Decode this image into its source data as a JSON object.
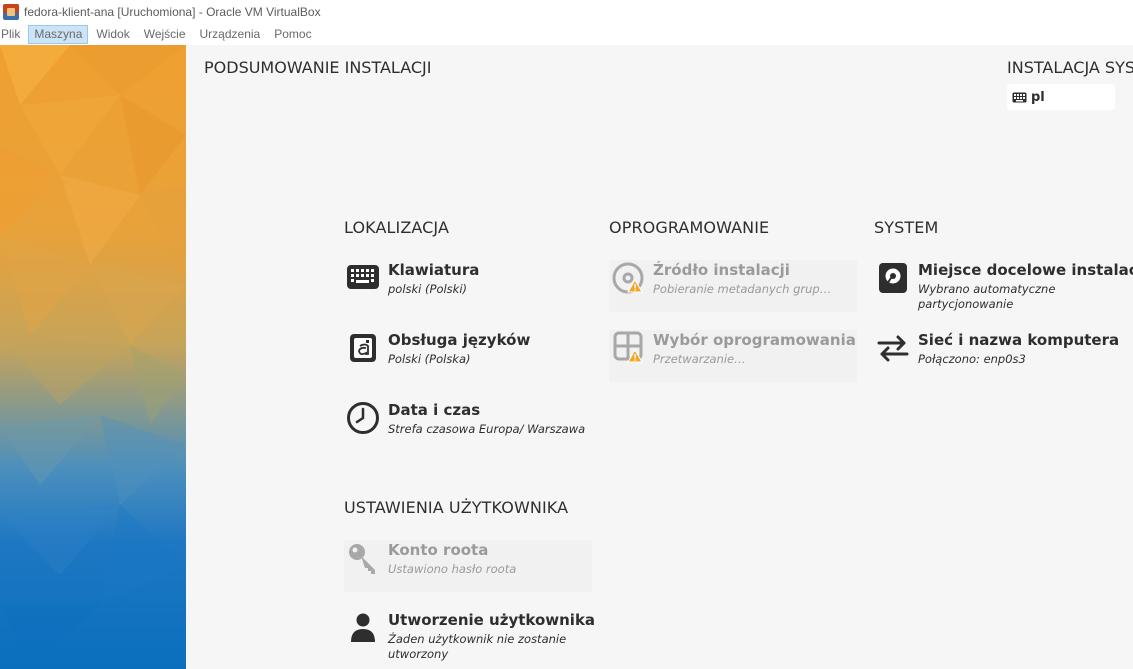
{
  "window": {
    "title": "fedora-klient-ana [Uruchomiona] - Oracle VM VirtualBox"
  },
  "menubar": {
    "items": [
      "Plik",
      "Maszyna",
      "Widok",
      "Wejście",
      "Urządzenia",
      "Pomoc"
    ],
    "active": "Maszyna"
  },
  "installer": {
    "page_title": "PODSUMOWANIE INSTALACJI",
    "product_title": "INSTALACJA SYST",
    "keyboard_layout": "pl"
  },
  "sections": {
    "localization": {
      "heading": "LOKALIZACJA",
      "spokes": [
        {
          "name": "Klawiatura",
          "status": "polski (Polski)",
          "icon": "keyboard-icon"
        },
        {
          "name": "Obsługa języków",
          "status": "Polski (Polska)",
          "icon": "language-icon"
        },
        {
          "name": "Data i czas",
          "status": "Strefa czasowa Europa/ Warszawa",
          "icon": "clock-icon"
        }
      ]
    },
    "software": {
      "heading": "OPROGRAMOWANIE",
      "spokes": [
        {
          "name": "Źródło instalacji",
          "status": "Pobieranie metadanych grup…",
          "icon": "install-source-icon",
          "disabled": true
        },
        {
          "name": "Wybór oprogramowania",
          "status": "Przetwarzanie…",
          "icon": "software-selection-icon",
          "disabled": true
        }
      ]
    },
    "system": {
      "heading": "SYSTEM",
      "spokes": [
        {
          "name": "Miejsce docelowe instalacji",
          "status": "Wybrano automatyczne partycjonowanie",
          "icon": "disk-icon"
        },
        {
          "name": "Sieć i nazwa komputera",
          "status": "Połączono: enp0s3",
          "icon": "network-icon"
        }
      ]
    },
    "user_settings": {
      "heading": "USTAWIENIA UŻYTKOWNIKA",
      "spokes": [
        {
          "name": "Konto roota",
          "status": "Ustawiono hasło roota",
          "icon": "key-icon",
          "disabled": true
        },
        {
          "name": "Utworzenie użytkownika",
          "status": "Żaden użytkownik nie zostanie utworzony",
          "icon": "user-icon"
        }
      ]
    }
  },
  "colors": {
    "sidebar_top": "#f0a030",
    "sidebar_bottom": "#0a6fbe",
    "text": "#2e2e2e",
    "disabled_text": "#9a9a9a",
    "warning": "#f5a623"
  }
}
